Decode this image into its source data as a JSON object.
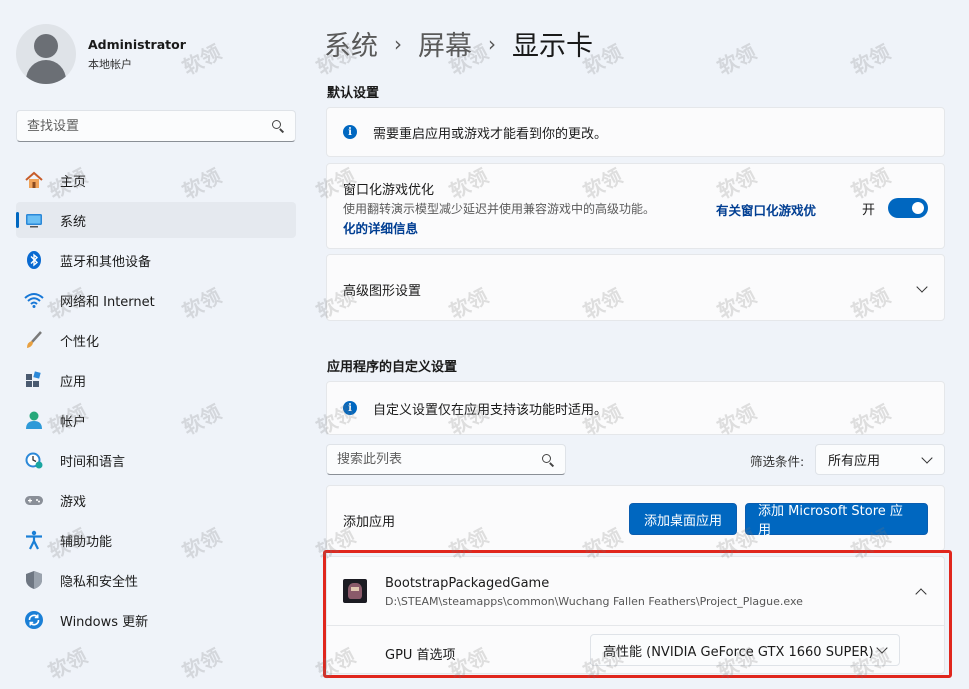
{
  "profile": {
    "name": "Administrator",
    "account_type": "本地帐户"
  },
  "sidebar": {
    "search_placeholder": "查找设置",
    "items": [
      {
        "label": "主页",
        "icon": "home-icon"
      },
      {
        "label": "系统",
        "icon": "system-icon",
        "active": true
      },
      {
        "label": "蓝牙和其他设备",
        "icon": "bluetooth-icon"
      },
      {
        "label": "网络和 Internet",
        "icon": "wifi-icon"
      },
      {
        "label": "个性化",
        "icon": "brush-icon"
      },
      {
        "label": "应用",
        "icon": "apps-icon"
      },
      {
        "label": "帐户",
        "icon": "account-icon"
      },
      {
        "label": "时间和语言",
        "icon": "clock-globe-icon"
      },
      {
        "label": "游戏",
        "icon": "gamepad-icon"
      },
      {
        "label": "辅助功能",
        "icon": "accessibility-icon"
      },
      {
        "label": "隐私和安全性",
        "icon": "shield-icon"
      },
      {
        "label": "Windows 更新",
        "icon": "update-icon"
      }
    ]
  },
  "breadcrumb": {
    "level1": "系统",
    "level2": "屏幕",
    "current": "显示卡",
    "separator": "›"
  },
  "default_settings": {
    "title": "默认设置",
    "restart_notice": "需要重启应用或游戏才能看到你的更改。",
    "windowed_opt": {
      "title": "窗口化游戏优化",
      "desc": "使用翻转演示模型减少延迟并使用兼容游戏中的高级功能。",
      "link_line1": "有关窗口化游戏优",
      "link_line2": "化的详细信息",
      "toggle_label": "开",
      "enabled": true
    },
    "advanced": {
      "title": "高级图形设置"
    }
  },
  "app_settings": {
    "title": "应用程序的自定义设置",
    "notice": "自定义设置仅在应用支持该功能时适用。",
    "list_search_placeholder": "搜索此列表",
    "filter_label": "筛选条件:",
    "filter_value": "所有应用",
    "add_app_label": "添加应用",
    "add_desktop_btn": "添加桌面应用",
    "add_store_btn": "添加 Microsoft Store 应用",
    "app": {
      "name": "BootstrapPackagedGame",
      "path": "D:\\STEAM\\steamapps\\common\\Wuchang Fallen Feathers\\Project_Plague.exe",
      "gpu_label": "GPU 首选项",
      "gpu_value": "高性能 (NVIDIA GeForce GTX 1660 SUPER)"
    }
  },
  "watermark_text": "软领",
  "colors": {
    "accent": "#0067c0",
    "highlight": "#e0261d",
    "background": "#eff3f9"
  }
}
